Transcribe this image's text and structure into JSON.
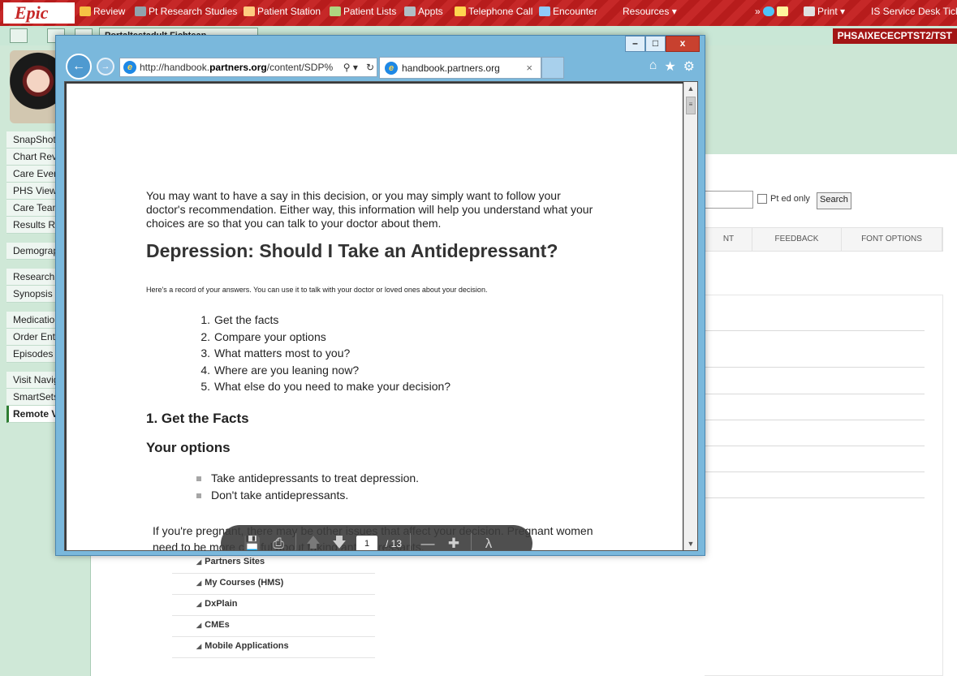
{
  "epic": {
    "logo": "Epic",
    "toolbar": [
      {
        "label": "Review",
        "icon": "folder-icon"
      },
      {
        "label": "Pt Research Studies",
        "icon": "research-icon"
      },
      {
        "label": "Patient Station",
        "icon": "patient-station-icon"
      },
      {
        "label": "Patient Lists",
        "icon": "patient-lists-icon"
      },
      {
        "label": "Appts",
        "icon": "appointments-icon"
      },
      {
        "label": "Telephone Call",
        "icon": "telephone-icon"
      },
      {
        "label": "Encounter",
        "icon": "encounter-icon"
      },
      {
        "label": "Resources ▾",
        "icon": "resources-icon"
      },
      {
        "label": "»",
        "icon": "more-icon"
      },
      {
        "label": "Print ▾",
        "icon": "print-icon"
      },
      {
        "label": "IS Service Desk Tick",
        "icon": "service-desk-icon"
      }
    ],
    "patient_tab": "Portaltestadult Fichtean",
    "environment": "PHSAIXECECPTST2/TST",
    "sidebar": [
      {
        "label": "SnapShot"
      },
      {
        "label": "Chart Review"
      },
      {
        "label": "Care Everywhere"
      },
      {
        "label": "PHS Viewer"
      },
      {
        "label": "Care Team"
      },
      {
        "label": "Results Review"
      },
      {
        "label": "Demographics"
      },
      {
        "label": "Research"
      },
      {
        "label": "Synopsis"
      },
      {
        "label": "Medications"
      },
      {
        "label": "Order Entry"
      },
      {
        "label": "Episodes"
      },
      {
        "label": "Visit Navigator"
      },
      {
        "label": "SmartSets"
      },
      {
        "label": "Remote View"
      }
    ],
    "search": {
      "pt_ed_label": "Pt ed only",
      "button": "Search"
    },
    "menu_tabs": [
      "NT",
      "FEEDBACK",
      "FONT OPTIONS"
    ],
    "links": [
      "Partners Sites",
      "My Courses (HMS)",
      "DxPlain",
      "CMEs",
      "Mobile Applications"
    ]
  },
  "ie": {
    "url_prefix": "http://handbook.",
    "url_domain": "partners.org",
    "url_suffix": "/content/SDP%",
    "tab_title": "handbook.partners.org",
    "tab_close": "×",
    "window_controls": {
      "minimize": "–",
      "maximize": "□",
      "close": "x"
    },
    "tools": [
      "home-icon",
      "favorites-icon",
      "settings-icon"
    ]
  },
  "pdf": {
    "intro": "You may want to have a say in this decision, or you may simply want to follow your doctor's recommendation. Either way, this information will help you understand what your choices are so that you can talk to your doctor about them.",
    "title": "Depression: Should I Take an Antidepressant?",
    "record_note": "Here's a record of your answers. You can use it to talk with your doctor or loved ones about your decision.",
    "steps": [
      {
        "num": "1.",
        "text": "Get the facts"
      },
      {
        "num": "2.",
        "text": "Compare your options"
      },
      {
        "num": "3.",
        "text": "What matters most to you?"
      },
      {
        "num": "4.",
        "text": "Where are you leaning now?"
      },
      {
        "num": "5.",
        "text": "What else do you need to make your decision?"
      }
    ],
    "section_heading": "1. Get the Facts",
    "options_heading": "Your options",
    "options": [
      "Take antidepressants to treat depression.",
      "Don't take antidepressants."
    ],
    "pregnancy_note": "If you're pregnant, there may be other issues that affect your decision. Pregnant women need to be more careful about taking antidepressants.",
    "viewer": {
      "current_page": "1",
      "total_pages": "/ 13"
    }
  }
}
